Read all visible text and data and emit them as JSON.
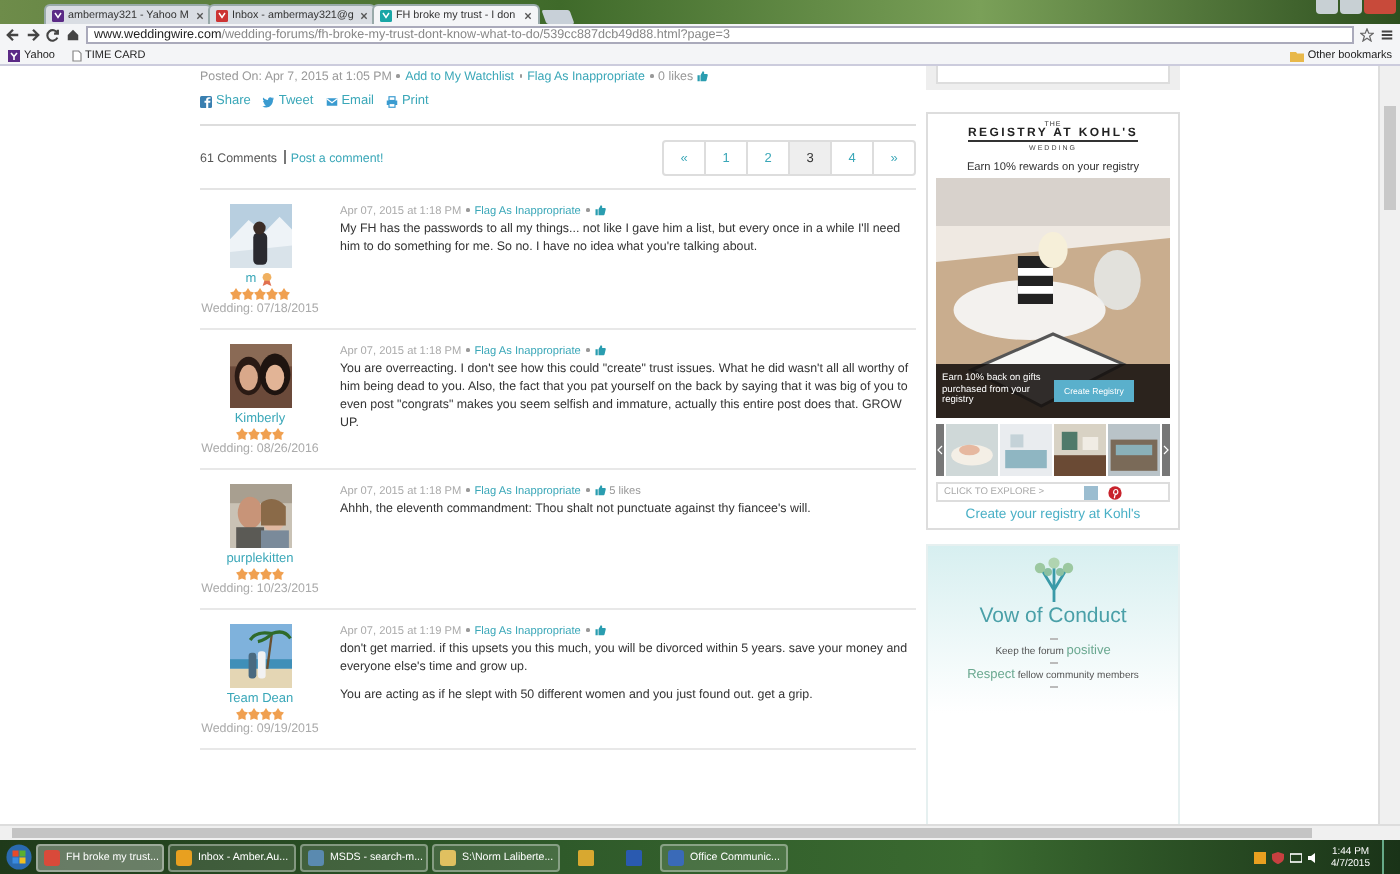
{
  "browser": {
    "tabs": [
      {
        "label": "ambermay321 - Yahoo M",
        "selected": false
      },
      {
        "label": "Inbox - ambermay321@g",
        "selected": false
      },
      {
        "label": "FH broke my trust - I don",
        "selected": true
      }
    ],
    "url_host": "www.weddingwire.com",
    "url_path": "/wedding-forums/fh-broke-my-trust-dont-know-what-to-do/539cc887dcb49d88.html?page=3",
    "bookmarks": [
      "Yahoo",
      "TIME CARD"
    ],
    "other_bookmarks": "Other bookmarks"
  },
  "post_meta": {
    "posted": "Posted On: Apr 7, 2015 at 1:05 PM",
    "watchlist": "Add to My Watchlist",
    "flag": "Flag As Inappropriate",
    "likes": "0 likes"
  },
  "share": [
    "Share",
    "Tweet",
    "Email",
    "Print"
  ],
  "comments_header": {
    "count": "61 Comments",
    "post_link": "Post a comment!"
  },
  "pagination": [
    {
      "label": "«",
      "selected": false
    },
    {
      "label": "1",
      "selected": false
    },
    {
      "label": "2",
      "selected": false
    },
    {
      "label": "3",
      "selected": true
    },
    {
      "label": "4",
      "selected": false
    },
    {
      "label": "»",
      "selected": false
    }
  ],
  "comments": [
    {
      "author": "m",
      "badge": true,
      "stars": 5,
      "wedding": "Wedding: 07/18/2015",
      "date": "Apr 07, 2015 at 1:18 PM",
      "flag": "Flag As Inappropriate",
      "paragraphs": [
        "My FH has the passwords to all my things... not like I gave him a list, but every once in a while I'll need him to do something for me. So no. I have no idea what you're talking about."
      ]
    },
    {
      "author": "Kimberly",
      "stars": 4,
      "wedding": "Wedding: 08/26/2016",
      "date": "Apr 07, 2015 at 1:18 PM",
      "flag": "Flag As Inappropriate",
      "paragraphs": [
        "You are overreacting. I don't see how this could \"create\" trust issues. What he did wasn't all all worthy of him being dead to you. Also, the fact that you pat yourself on the back by saying that it was big of you to even post \"congrats\" makes you seem selfish and immature, actually this entire post does that. GROW UP."
      ]
    },
    {
      "author": "purplekitten",
      "stars": 4,
      "wedding": "Wedding: 10/23/2015",
      "date": "Apr 07, 2015 at 1:18 PM",
      "flag": "Flag As Inappropriate",
      "likes": "5 likes",
      "paragraphs": [
        "Ahhh, the eleventh commandment: Thou shalt not punctuate against thy fiancee's will."
      ]
    },
    {
      "author": "Team Dean",
      "stars": 4,
      "wedding": "Wedding: 09/19/2015",
      "date": "Apr 07, 2015 at 1:19 PM",
      "flag": "Flag As Inappropriate",
      "paragraphs": [
        "don't get married. if this upsets you this much, you will be divorced within 5 years. save your money and everyone else's time and grow up.",
        "You are acting as if he slept with 50 different women and you just found out. get a grip."
      ]
    }
  ],
  "ad": {
    "logo_top": "THE",
    "logo": "REGISTRY AT KOHL'S",
    "logo_bottom": "WEDDING",
    "headline": "Earn 10% rewards on your registry",
    "overlay_text": "Earn 10% back on gifts purchased from your registry",
    "button": "Create Registry",
    "explore": "CLICK TO EXPLORE >",
    "link": "Create your registry at Kohl's"
  },
  "vow": {
    "title": "Vow of Conduct",
    "lines": [
      "Keep the forum **positive**",
      "**Respect** fellow community members"
    ]
  },
  "taskbar": {
    "items": [
      {
        "kind": "window",
        "label": "FH broke my trust...",
        "selected": true
      },
      {
        "kind": "window",
        "label": "Inbox - Amber.Au...",
        "selected": false
      },
      {
        "kind": "window",
        "label": "MSDS - search-m...",
        "selected": false
      },
      {
        "kind": "window",
        "label": "S:\\Norm Laliberte...",
        "selected": false
      },
      {
        "kind": "pinned",
        "selected": false
      },
      {
        "kind": "pinned",
        "selected": false
      },
      {
        "kind": "window",
        "label": "Office Communic...",
        "selected": false
      }
    ],
    "time": "1:44 PM",
    "date": "4/7/2015"
  }
}
